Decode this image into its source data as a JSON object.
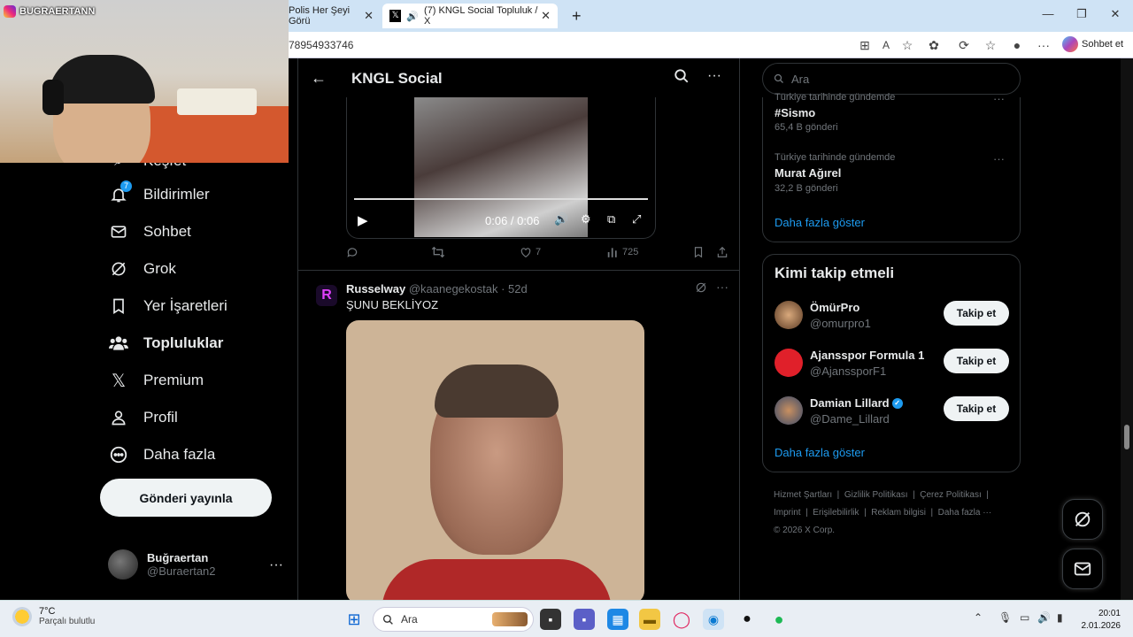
{
  "browser": {
    "tabs": [
      {
        "label": "Polis Her Şeyi Görü"
      },
      {
        "label": "(7) KNGL Social Topluluk / X"
      }
    ],
    "url": "78954933746",
    "chat_label": "Sohbet et"
  },
  "webcam": {
    "overlay_name": "BUGRAERTANN"
  },
  "nav": {
    "badge_count": "7",
    "items": [
      {
        "label": "Keşfet"
      },
      {
        "label": "Bildirimler"
      },
      {
        "label": "Sohbet"
      },
      {
        "label": "Grok"
      },
      {
        "label": "Yer İşaretleri"
      },
      {
        "label": "Topluluklar"
      },
      {
        "label": "Premium"
      },
      {
        "label": "Profil"
      },
      {
        "label": "Daha fazla"
      }
    ],
    "post_button": "Gönderi yayınla",
    "profile": {
      "name": "Buğraertan",
      "handle": "@Buraertan2"
    }
  },
  "center": {
    "title": "KNGL Social",
    "video": {
      "time": "0:06 / 0:06"
    },
    "tweet1_stats": {
      "likes": "7",
      "views": "725"
    },
    "tweet2": {
      "avatar_letter": "R",
      "name": "Russelway",
      "handle": "@kaanegekostak",
      "time": "· 52d",
      "text": "ŞUNU BEKLİYOZ"
    }
  },
  "right": {
    "search_placeholder": "Ara",
    "trends": [
      {
        "context": "Türkiye tarihinde gündemde",
        "name": "#Sismo",
        "count": "65,4 B gönderi"
      },
      {
        "context": "Türkiye tarihinde gündemde",
        "name": "Murat Ağırel",
        "count": "32,2 B gönderi"
      }
    ],
    "trends_show_more": "Daha fazla göster",
    "who_to_follow": {
      "title": "Kimi takip etmeli",
      "users": [
        {
          "name": "ÖmürPro",
          "handle": "@omurpro1",
          "button": "Takip et",
          "verified": false
        },
        {
          "name": "Ajansspor Formula 1",
          "handle": "@AjanssporF1",
          "button": "Takip et",
          "verified": false
        },
        {
          "name": "Damian Lillard",
          "handle": "@Dame_Lillard",
          "button": "Takip et",
          "verified": true
        }
      ],
      "show_more": "Daha fazla göster"
    },
    "footer": {
      "links": [
        "Hizmet Şartları",
        "Gizlilik Politikası",
        "Çerez Politikası",
        "Imprint",
        "Erişilebilirlik",
        "Reklam bilgisi",
        "Daha fazla ···"
      ],
      "copyright": "© 2026 X Corp."
    }
  },
  "taskbar": {
    "weather_temp": "7°C",
    "weather_desc": "Parçalı bulutlu",
    "search_label": "Ara",
    "time": "20:01",
    "date": "2.01.2026"
  },
  "colors": {
    "accent": "#1d9bf0",
    "background": "#000000",
    "border": "#2f3336"
  }
}
